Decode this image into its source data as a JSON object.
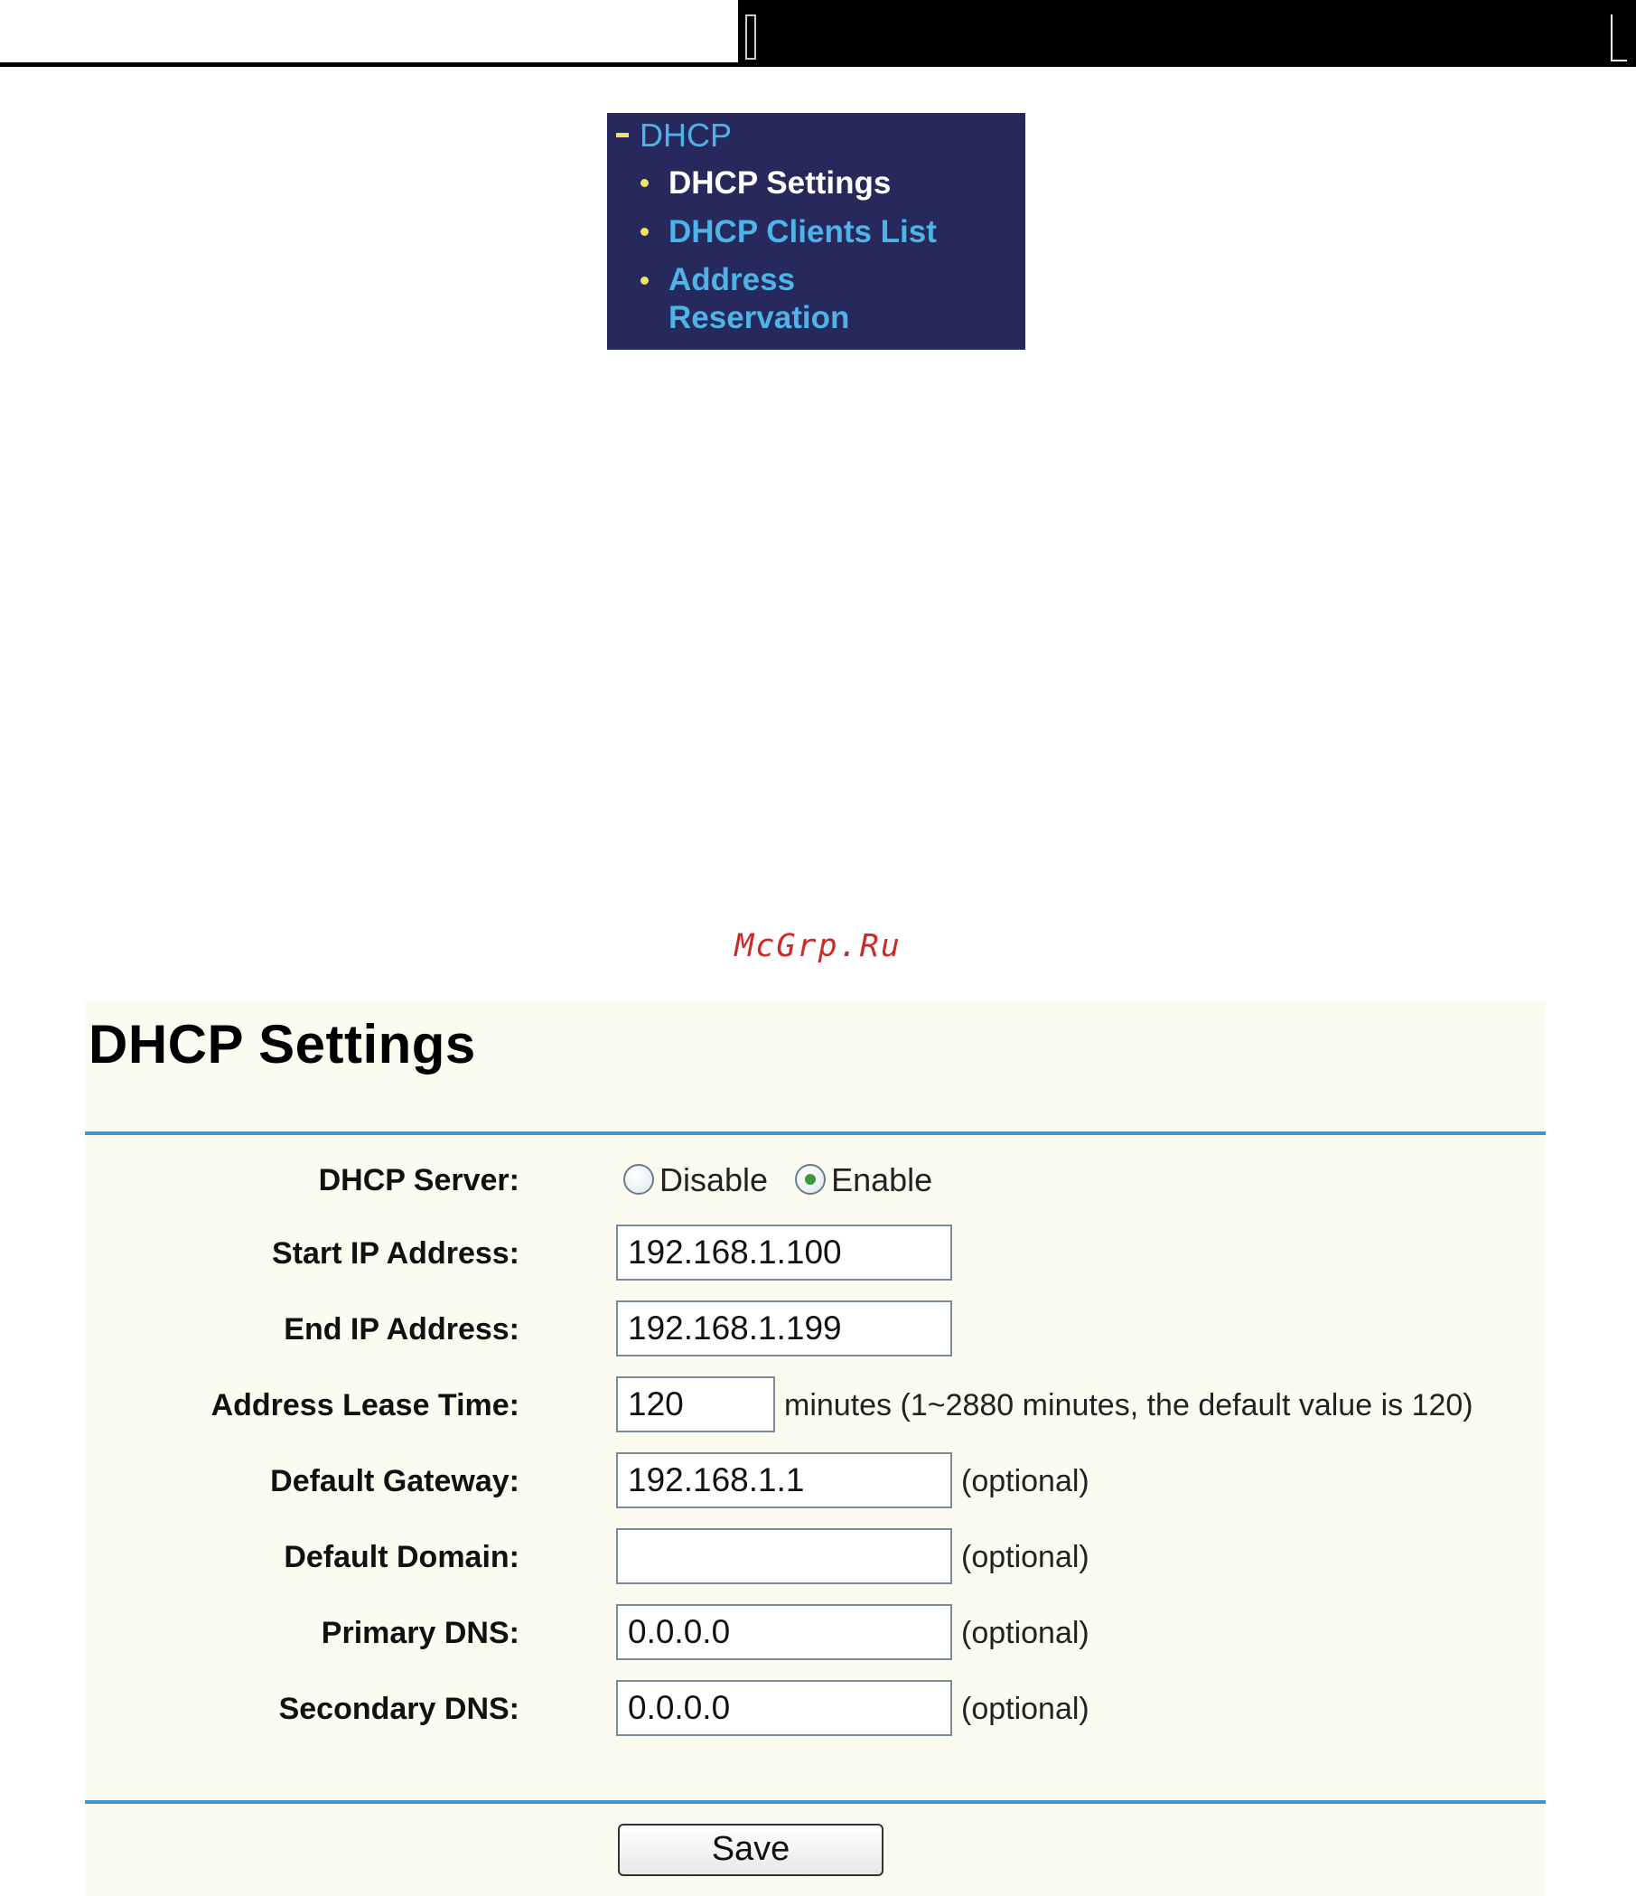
{
  "nav_menu": {
    "heading": "DHCP",
    "items": [
      {
        "label": "DHCP Settings",
        "active": true
      },
      {
        "label": "DHCP Clients List",
        "active": false
      },
      {
        "label": "Address Reservation",
        "label_line1": "Address",
        "label_line2": "Reservation",
        "active": false
      }
    ],
    "colors": {
      "background": "#27285c",
      "link": "#4fb3e8",
      "active": "#ffffff",
      "bullet": "#f1e26a"
    }
  },
  "watermark": "McGrp.Ru",
  "settings": {
    "title": "DHCP Settings",
    "dhcp_server": {
      "label": "DHCP Server:",
      "options": [
        "Disable",
        "Enable"
      ],
      "selected": "Enable"
    },
    "start_ip": {
      "label": "Start IP Address:",
      "value": "192.168.1.100"
    },
    "end_ip": {
      "label": "End IP Address:",
      "value": "192.168.1.199"
    },
    "lease_time": {
      "label": "Address Lease Time:",
      "value": "120",
      "note": "minutes (1~2880 minutes, the default value is 120)"
    },
    "default_gateway": {
      "label": "Default Gateway:",
      "value": "192.168.1.1",
      "note": "(optional)"
    },
    "default_domain": {
      "label": "Default Domain:",
      "value": "",
      "note": "(optional)"
    },
    "primary_dns": {
      "label": "Primary DNS:",
      "value": "0.0.0.0",
      "note": "(optional)"
    },
    "secondary_dns": {
      "label": "Secondary DNS:",
      "value": "0.0.0.0",
      "note": "(optional)"
    },
    "save_label": "Save",
    "colors": {
      "panel_background": "#fbfcef",
      "rule": "#4a8fc8"
    }
  }
}
